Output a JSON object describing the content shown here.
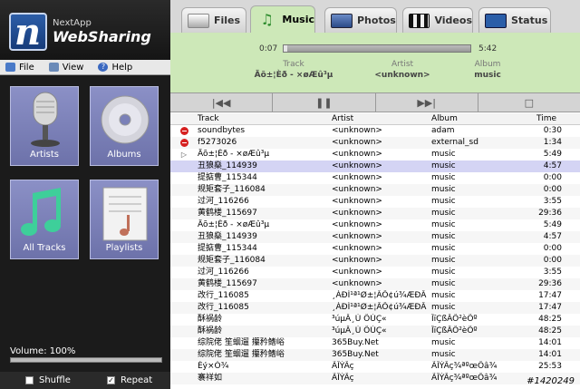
{
  "brand": {
    "small": "NextApp",
    "big": "WebSharing",
    "logo_letter": "n"
  },
  "menu": [
    {
      "label": "File",
      "icon": "file-icon"
    },
    {
      "label": "View",
      "icon": "view-icon"
    },
    {
      "label": "Help",
      "icon": "help-icon"
    }
  ],
  "tiles": {
    "artists": "Artists",
    "albums": "Albums",
    "all_tracks": "All Tracks",
    "playlists": "Playlists"
  },
  "volume": {
    "label": "Volume: 100%",
    "level": 1.0
  },
  "options": {
    "shuffle": "Shuffle",
    "shuffle_checked": false,
    "repeat": "Repeat",
    "repeat_checked": true
  },
  "tabs": [
    {
      "label": "Files",
      "active": false
    },
    {
      "label": "Music",
      "active": true
    },
    {
      "label": "Photos",
      "active": false
    },
    {
      "label": "Videos",
      "active": false
    },
    {
      "label": "Status",
      "active": false
    }
  ],
  "now_playing": {
    "time_start": "0:07",
    "time_end": "5:42",
    "progress": 0.02,
    "track_head": "Track",
    "track_val": "Äõ±¦Èð - ×øÆû³µ",
    "artist_head": "Artist",
    "artist_val": "<unknown>",
    "album_head": "Album",
    "album_val": "music"
  },
  "table": {
    "headers": {
      "track": "Track",
      "artist": "Artist",
      "album": "Album",
      "time": "Time"
    },
    "rows": [
      {
        "icon": "error",
        "track": "soundbytes",
        "artist": "<unknown>",
        "album": "adam",
        "time": "0:30"
      },
      {
        "icon": "error",
        "track": "f5273026",
        "artist": "<unknown>",
        "album": "external_sd",
        "time": "1:34"
      },
      {
        "icon": "play",
        "track": "Äõ±¦Èð - ×øÆû³µ",
        "artist": "<unknown>",
        "album": "music",
        "time": "5:49"
      },
      {
        "icon": "",
        "track": "丑狼燊_114939",
        "artist": "<unknown>",
        "album": "music",
        "time": "4:57",
        "selected": true
      },
      {
        "icon": "",
        "track": "提掂曹_115344",
        "artist": "<unknown>",
        "album": "music",
        "time": "0:00"
      },
      {
        "icon": "",
        "track": "规矩套子_116084",
        "artist": "<unknown>",
        "album": "music",
        "time": "0:00"
      },
      {
        "icon": "",
        "track": "过河_116266",
        "artist": "<unknown>",
        "album": "music",
        "time": "3:55"
      },
      {
        "icon": "",
        "track": "黄鹤楼_115697",
        "artist": "<unknown>",
        "album": "music",
        "time": "29:36"
      },
      {
        "icon": "",
        "track": "Äõ±¦Èð - ×øÆû³µ",
        "artist": "<unknown>",
        "album": "music",
        "time": "5:49"
      },
      {
        "icon": "",
        "track": "丑狼燊_114939",
        "artist": "<unknown>",
        "album": "music",
        "time": "4:57"
      },
      {
        "icon": "",
        "track": "提掂曹_115344",
        "artist": "<unknown>",
        "album": "music",
        "time": "0:00"
      },
      {
        "icon": "",
        "track": "规矩套子_116084",
        "artist": "<unknown>",
        "album": "music",
        "time": "0:00"
      },
      {
        "icon": "",
        "track": "过河_116266",
        "artist": "<unknown>",
        "album": "music",
        "time": "3:55"
      },
      {
        "icon": "",
        "track": "黄鹤楼_115697",
        "artist": "<unknown>",
        "album": "music",
        "time": "29:36"
      },
      {
        "icon": "",
        "track": "改行_116085",
        "artist": "¸ÀÐÌ¹ª¹Ø±¦ÃÔ¢ú¾ÆÐÂ",
        "album": "music",
        "time": "17:47"
      },
      {
        "icon": "",
        "track": "改行_116085",
        "artist": "¸ÀÐÌ¹ª¹Ø±¦ÃÔ¢ú¾ÆÐÂ",
        "album": "music",
        "time": "17:47"
      },
      {
        "icon": "",
        "track": "酥祸龄",
        "artist": "³úµÂ¸Ù ÔÚÇ«",
        "album": "ÎïÇßÂÔ²èÕº",
        "time": "48:25"
      },
      {
        "icon": "",
        "track": "酥祸龄",
        "artist": "³úµÂ¸Ù ÔÚÇ«",
        "album": "ÎïÇßÂÔ²èÕº",
        "time": "48:25"
      },
      {
        "icon": "",
        "track": "综院佬 笙蛔遛 攥矜鳍峪",
        "artist": "365Buy.Net",
        "album": "music",
        "time": "14:01"
      },
      {
        "icon": "",
        "track": "综院佬 笙蛔遛 攥矜鳍峪",
        "artist": "365Buy.Net",
        "album": "music",
        "time": "14:01"
      },
      {
        "icon": "",
        "track": "Èý×Ó¾",
        "artist": "ÃÎÝÂç",
        "album": "ÃÎÝÂç¾ªºœÕâ¾",
        "time": "25:53"
      },
      {
        "icon": "",
        "track": "褰祥如",
        "artist": "ÃÎÝÂç",
        "album": "ÃÎÝÂç¾ªºœÕâ¾",
        "time": ""
      }
    ]
  },
  "watermark": "#1420249"
}
